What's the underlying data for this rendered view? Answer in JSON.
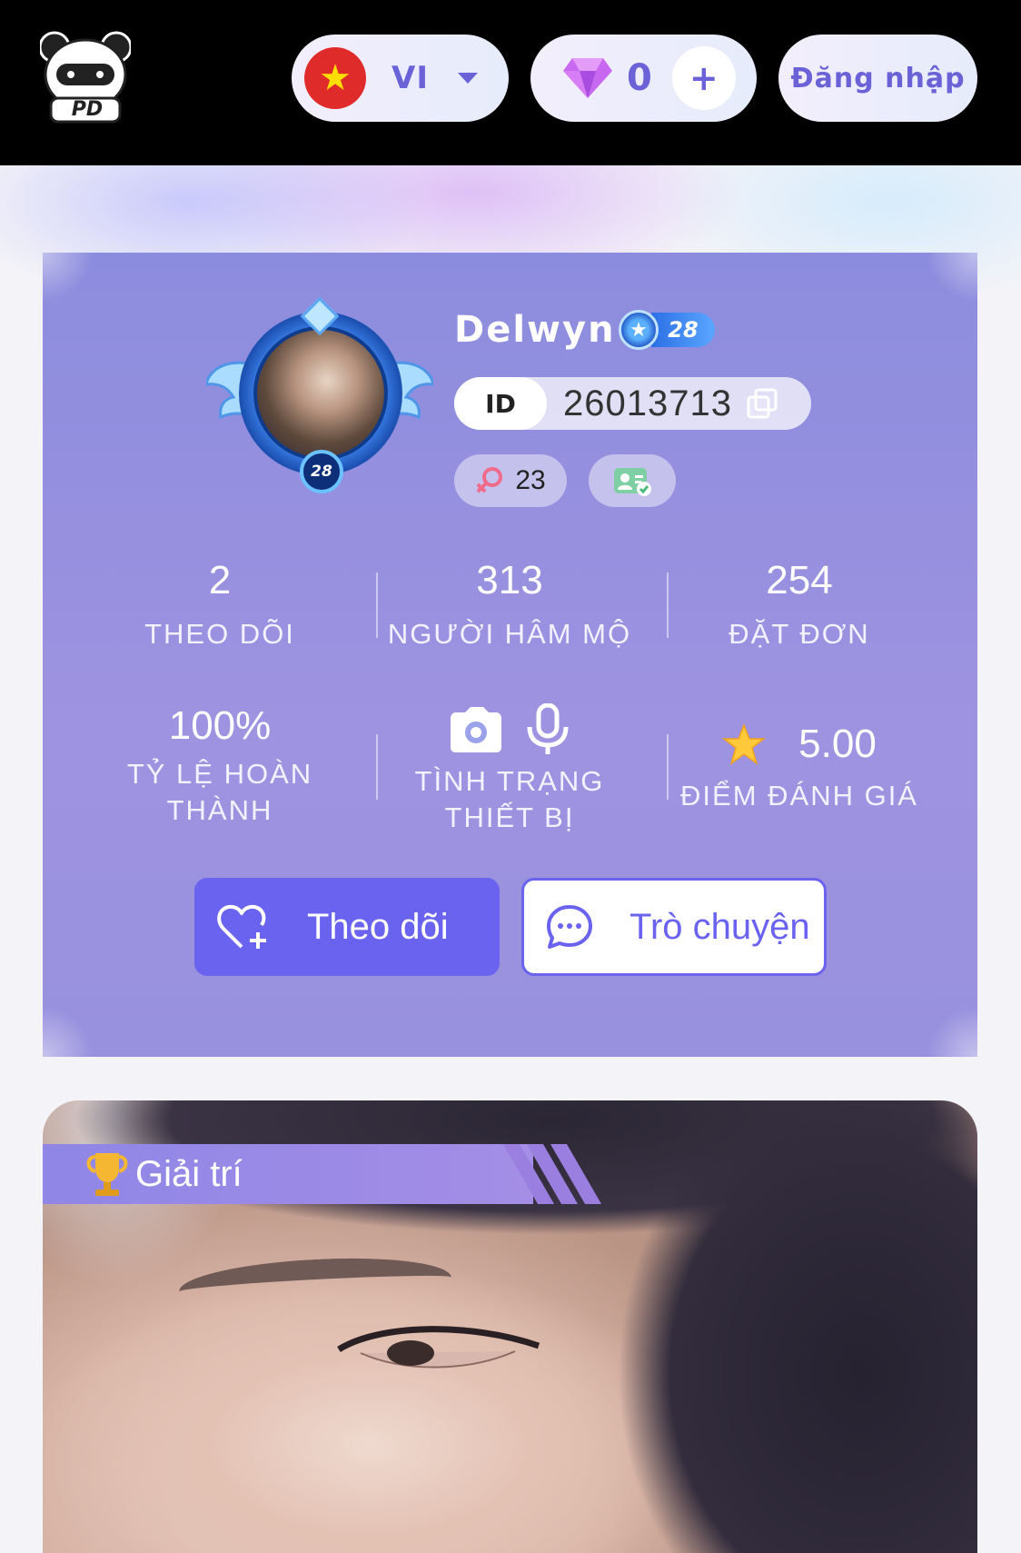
{
  "header": {
    "logo_text": "PD",
    "language": {
      "code": "VI",
      "flag": "vietnam-flag"
    },
    "gems": {
      "count": "0",
      "add_label": "+"
    },
    "login_label": "Đăng nhập"
  },
  "profile": {
    "username": "Delwyn",
    "level": "28",
    "id_tag": "ID",
    "id_value": "26013713",
    "gender_count": "23",
    "stats": [
      {
        "value": "2",
        "label": "THEO DÕI"
      },
      {
        "value": "313",
        "label": "NGƯỜI HÂM MỘ"
      },
      {
        "value": "254",
        "label": "ĐẶT ĐƠN"
      }
    ],
    "completion": {
      "value": "100%",
      "label_line1": "TỶ LỆ HOÀN",
      "label_line2": "THÀNH"
    },
    "device": {
      "label_line1": "TÌNH TRẠNG",
      "label_line2": "THIẾT BỊ"
    },
    "rating": {
      "value": "5.00",
      "label": "ĐIỂM ĐÁNH GIÁ"
    },
    "follow_button": "Theo dõi",
    "chat_button": "Trò chuyện"
  },
  "photo_card": {
    "category": "Giải trí"
  },
  "colors": {
    "accent": "#6a63ef",
    "card_bg": "#9891de",
    "header_bg": "#000000"
  }
}
